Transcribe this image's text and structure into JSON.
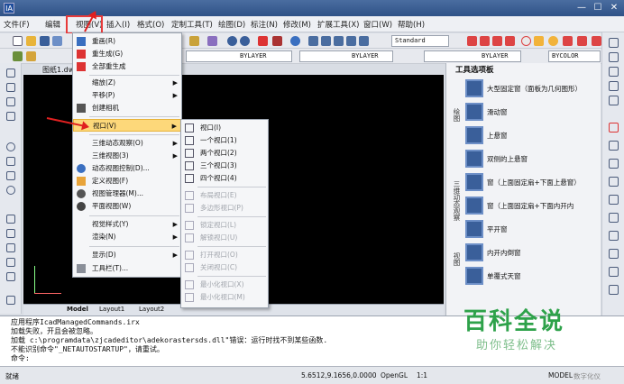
{
  "window": {
    "title": "",
    "controls": [
      "—",
      "☐",
      "✕"
    ],
    "app_icon": "IA"
  },
  "menubar": {
    "items": [
      "文件(F)",
      "编辑",
      "视图(V)",
      "插入(I)",
      "格式(O)",
      "定制工具(T)",
      "绘图(D)",
      "标注(N)",
      "修改(M)",
      "扩展工具(X)",
      "窗口(W)",
      "帮助(H)"
    ]
  },
  "toolbar": {
    "text_style": "Standard",
    "layer": "BYLAYER",
    "linetype": "BYLAYER",
    "lineweight": "BYLAYER",
    "color": "BYCOLOR"
  },
  "document": {
    "tab": "图纸1.dw"
  },
  "layout_tabs": [
    "Model",
    "Layout1",
    "Layout2"
  ],
  "view_menu": {
    "items": [
      {
        "label": "重画(R)",
        "icon": "redraw-icon"
      },
      {
        "label": "重生成(G)",
        "icon": "regen-icon"
      },
      {
        "label": "全部重生成",
        "icon": "regen-all-icon"
      },
      {
        "label": "缩放(Z)",
        "submenu": true
      },
      {
        "label": "平移(P)",
        "submenu": true
      },
      {
        "label": "创建相机",
        "icon": "camera-icon"
      },
      {
        "label": "视口(V)",
        "submenu": true,
        "highlighted": true
      },
      {
        "label": "三维动态观察(O)",
        "submenu": true
      },
      {
        "label": "三维视图(3)",
        "submenu": true
      },
      {
        "label": "动态视图控制(D)...",
        "icon": "dynamic-view-icon"
      },
      {
        "label": "定义视图(F)",
        "icon": "define-view-icon"
      },
      {
        "label": "视图管理器(M)...",
        "icon": "view-manager-icon"
      },
      {
        "label": "平面视图(W)",
        "icon": "plan-view-icon"
      },
      {
        "label": "视觉样式(Y)",
        "submenu": true
      },
      {
        "label": "渲染(N)",
        "submenu": true
      },
      {
        "label": "显示(D)",
        "submenu": true
      },
      {
        "label": "工具栏(T)...",
        "icon": "toolbar-icon"
      }
    ]
  },
  "viewport_submenu": {
    "items": [
      {
        "label": "视口(I)",
        "disabled": false
      },
      {
        "label": "一个视口(1)",
        "disabled": false
      },
      {
        "label": "两个视口(2)",
        "disabled": false
      },
      {
        "label": "三个视口(3)",
        "disabled": false
      },
      {
        "label": "四个视口(4)",
        "disabled": false
      },
      {
        "label": "布局视口(E)",
        "disabled": true
      },
      {
        "label": "多边形视口(P)",
        "disabled": true
      },
      {
        "label": "锁定视口(L)",
        "disabled": true
      },
      {
        "label": "解锁视口(U)",
        "disabled": true
      },
      {
        "label": "打开视口(O)",
        "disabled": true
      },
      {
        "label": "关闭视口(C)",
        "disabled": true
      },
      {
        "label": "最小化视口(X)",
        "disabled": true
      },
      {
        "label": "最小化视口(M)",
        "disabled": true
      }
    ]
  },
  "tool_palette": {
    "title": "工具选项板",
    "side_tabs": [
      "绘图",
      "三维动态观察",
      "视图"
    ],
    "items": [
      "大型固定窗（面板为几何图形）",
      "滑动窗",
      "上悬窗",
      "双侧的上悬窗",
      "窗（上面固定扇+下面上悬窗）",
      "窗（上面固定扇+下面内开内",
      "平开窗",
      "内开内倒窗",
      "单覆式天窗"
    ]
  },
  "command_line": {
    "lines": [
      "应用程序IcadManagedCommands.irx",
      "加载失败，开且会被忽略。",
      "加载 c:\\programdata\\zjcadeditor\\adekorastersds.dll\"错误：运行时找不到某些函数.",
      "不能识别命令\"_NETAUTOSTARTUP\"，请重试。",
      "命令:"
    ]
  },
  "statusbar": {
    "status": "就绪",
    "coords": "5.6512,9.1656,0.0000",
    "renderer": "OpenGL",
    "scale": "1:1",
    "model": "MODEL",
    "extra": "数字化仪"
  },
  "watermark": {
    "title": "百科全说",
    "subtitle": "助你轻松解决"
  },
  "colors": {
    "highlight": "#fdd87a",
    "annotation_red": "#e02020",
    "drawing_bg": "#000000"
  }
}
